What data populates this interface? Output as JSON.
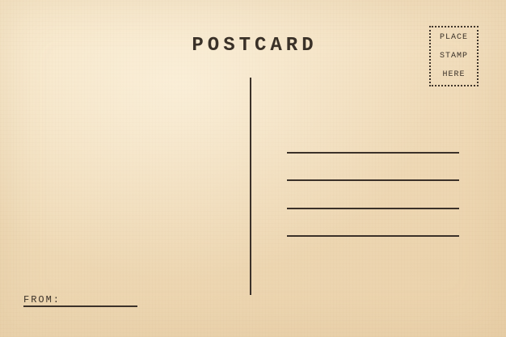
{
  "postcard": {
    "title": "POSTCARD",
    "stamp_box": {
      "lines": [
        "PLACE",
        "STAMP",
        "HERE"
      ]
    },
    "address_line_count": 4,
    "from_label": "FROM:"
  },
  "colors": {
    "paper": "#f3e3c6",
    "ink": "#3a3128"
  }
}
